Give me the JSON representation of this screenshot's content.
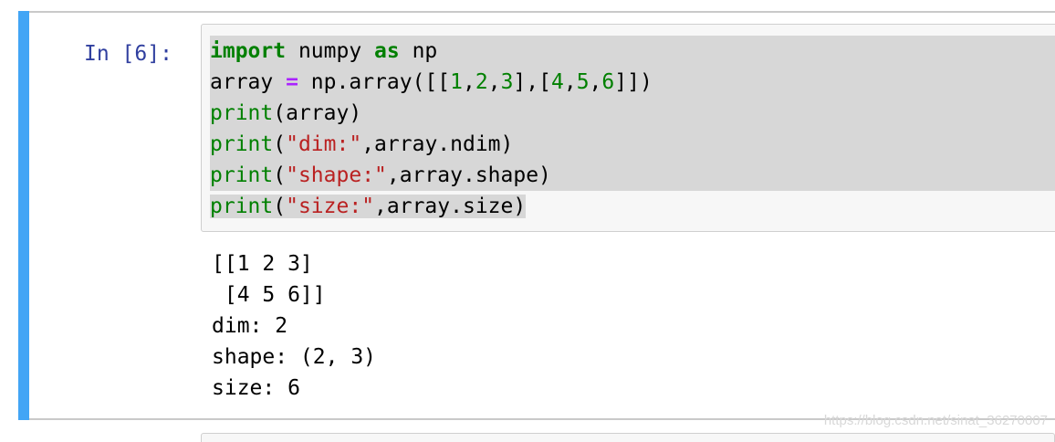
{
  "cell": {
    "prompt": "In [6]:",
    "accent_color": "#42a5f5",
    "code_lines": [
      [
        {
          "t": "import",
          "c": "kw"
        },
        {
          "t": " numpy ",
          "c": ""
        },
        {
          "t": "as",
          "c": "kw"
        },
        {
          "t": " np",
          "c": ""
        }
      ],
      [
        {
          "t": "array ",
          "c": ""
        },
        {
          "t": "=",
          "c": "op"
        },
        {
          "t": " np.array([[",
          "c": ""
        },
        {
          "t": "1",
          "c": "num"
        },
        {
          "t": ",",
          "c": ""
        },
        {
          "t": "2",
          "c": "num"
        },
        {
          "t": ",",
          "c": ""
        },
        {
          "t": "3",
          "c": "num"
        },
        {
          "t": "],[",
          "c": ""
        },
        {
          "t": "4",
          "c": "num"
        },
        {
          "t": ",",
          "c": ""
        },
        {
          "t": "5",
          "c": "num"
        },
        {
          "t": ",",
          "c": ""
        },
        {
          "t": "6",
          "c": "num"
        },
        {
          "t": "]])",
          "c": ""
        }
      ],
      [
        {
          "t": "print",
          "c": "bi"
        },
        {
          "t": "(array)",
          "c": ""
        }
      ],
      [
        {
          "t": "print",
          "c": "bi"
        },
        {
          "t": "(",
          "c": ""
        },
        {
          "t": "\"dim:\"",
          "c": "str"
        },
        {
          "t": ",array.ndim)",
          "c": ""
        }
      ],
      [
        {
          "t": "print",
          "c": "bi"
        },
        {
          "t": "(",
          "c": ""
        },
        {
          "t": "\"shape:\"",
          "c": "str"
        },
        {
          "t": ",array.shape)",
          "c": ""
        }
      ],
      [
        {
          "t": "print",
          "c": "bi"
        },
        {
          "t": "(",
          "c": ""
        },
        {
          "t": "\"size:\"",
          "c": "str"
        },
        {
          "t": ",array.size)",
          "c": ""
        }
      ]
    ],
    "output_lines": [
      "[[1 2 3]",
      " [4 5 6]]",
      "dim: 2",
      "shape: (2, 3)",
      "size: 6"
    ]
  },
  "watermark": "https://blog.csdn.net/sinat_36270007"
}
